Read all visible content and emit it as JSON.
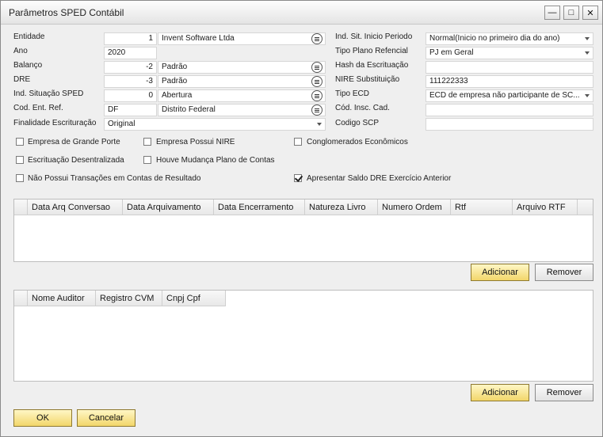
{
  "window": {
    "title": "Parâmetros SPED Contábil",
    "minimize_label": "—",
    "maximize_label": "□",
    "close_label": "✕"
  },
  "left_form": {
    "entidade": {
      "label": "Entidade",
      "code": "1",
      "name": "Invent Software Ltda"
    },
    "ano": {
      "label": "Ano",
      "value": "2020"
    },
    "balanco": {
      "label": "Balanço",
      "code": "-2",
      "name": "Padrão"
    },
    "dre": {
      "label": "DRE",
      "code": "-3",
      "name": "Padrão"
    },
    "ind_situacao": {
      "label": "Ind. Situação SPED",
      "code": "0",
      "name": "Abertura"
    },
    "cod_ent_ref": {
      "label": "Cod. Ent. Ref.",
      "code": "DF",
      "name": "Distrito Federal"
    },
    "finalidade": {
      "label": "Finalidade Escrituração",
      "value": "Original"
    }
  },
  "right_form": {
    "ind_sit_inicio": {
      "label": "Ind. Sit. Inicio Periodo",
      "value": "Normal(Inicio no primeiro dia do ano)"
    },
    "tipo_plano": {
      "label": "Tipo Plano Refencial",
      "value": "PJ em Geral"
    },
    "hash": {
      "label": "Hash da Escrituação",
      "value": ""
    },
    "nire": {
      "label": "NIRE Substituição",
      "value": "111222333"
    },
    "tipo_ecd": {
      "label": "Tipo ECD",
      "value": "ECD de empresa não participante de SC..."
    },
    "cod_insc": {
      "label": "Cód. Insc. Cad.",
      "value": ""
    },
    "codigo_scp": {
      "label": "Codigo SCP",
      "value": ""
    }
  },
  "checkboxes": [
    {
      "label": "Empresa de Grande Porte",
      "checked": false
    },
    {
      "label": "Empresa Possui NIRE",
      "checked": false
    },
    {
      "label": "Conglomerados Econômicos",
      "checked": false
    },
    {
      "label": "Escrituação Desentralizada",
      "checked": false
    },
    {
      "label": "Houve Mudança Plano de Contas",
      "checked": false
    },
    {
      "label": "Não Possui Transações em Contas de Resultado",
      "checked": false
    },
    {
      "label": "Apresentar Saldo DRE Exercício Anterior",
      "checked": true
    }
  ],
  "grid1": {
    "columns": [
      "Data Arq Conversao",
      "Data Arquivamento",
      "Data Encerramento",
      "Natureza Livro",
      "Numero Ordem",
      "Rtf",
      "Arquivo RTF"
    ]
  },
  "grid2": {
    "columns": [
      "Nome Auditor",
      "Registro CVM",
      "Cnpj Cpf"
    ]
  },
  "buttons": {
    "adicionar": "Adicionar",
    "remover": "Remover",
    "ok": "OK",
    "cancelar": "Cancelar"
  }
}
